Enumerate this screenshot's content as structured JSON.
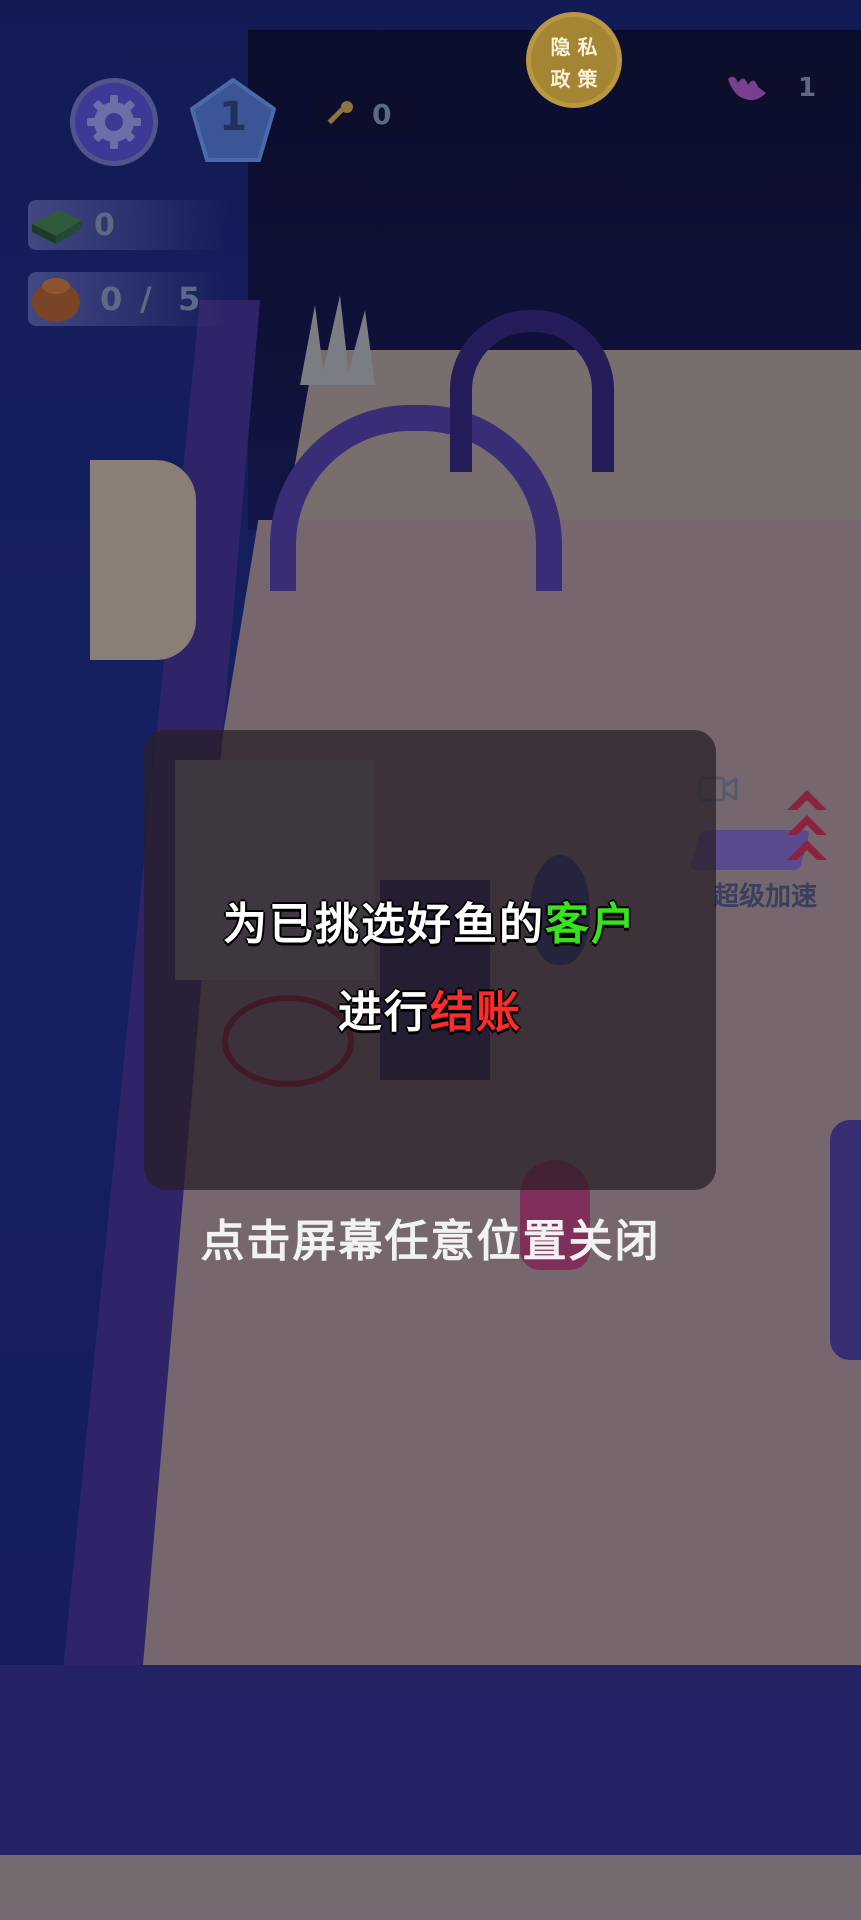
{
  "hud": {
    "level": "1",
    "keys": "0",
    "cash": "0",
    "capacity_current": "0",
    "capacity_sep": "/",
    "capacity_max": "5",
    "gems": "1"
  },
  "privacy_button": {
    "line1": "隐 私",
    "line2": "政 策"
  },
  "speed_boost": {
    "label": "超级加速"
  },
  "tutorial": {
    "line1_prefix": "为已挑选好鱼的",
    "line1_highlight": "客户",
    "line2_prefix": "进行",
    "line2_highlight": "结账",
    "highlight_colors": {
      "customer": "#38e21e",
      "checkout": "#ff2a2a"
    }
  },
  "close_hint": "点击屏幕任意位置关闭",
  "icons": {
    "settings": "gear-icon",
    "level": "pentagon-badge-icon",
    "key": "key-icon",
    "cash": "cash-stack-icon",
    "capacity": "fish-bag-icon",
    "gem": "gem-icon",
    "video": "video-ad-icon"
  }
}
